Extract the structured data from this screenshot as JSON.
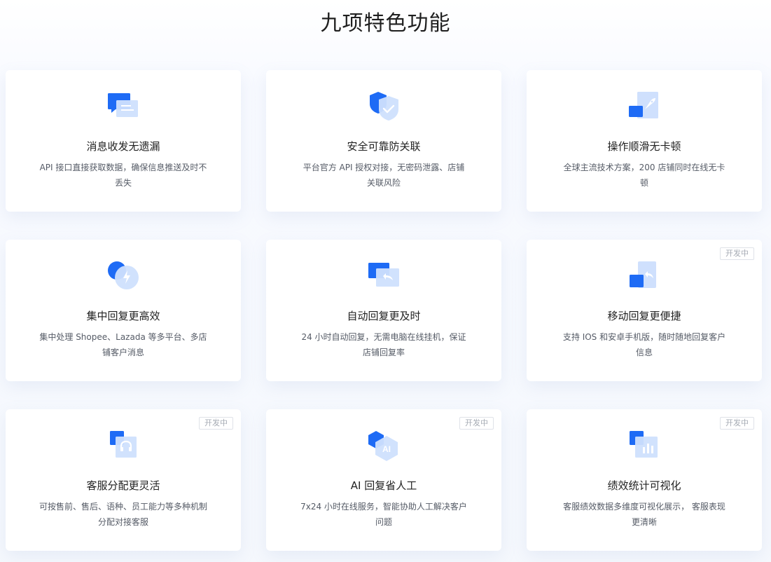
{
  "header": {
    "title": "九项特色功能"
  },
  "colors": {
    "accent": "#1e6bf5",
    "accent_light": "#cfe0fd"
  },
  "features": [
    {
      "title": "消息收发无遗漏",
      "desc": "API 接口直接获取数据，确保信息推送及时不丢失",
      "icon": "chat-bubbles-icon",
      "badge": ""
    },
    {
      "title": "安全可靠防关联",
      "desc": "平台官方 API 授权对接，无密码泄露、店铺关联风险",
      "icon": "shield-check-icon",
      "badge": ""
    },
    {
      "title": "操作顺滑无卡顿",
      "desc": "全球主流技术方案，200 店铺同时在线无卡顿",
      "icon": "rocket-icon",
      "badge": ""
    },
    {
      "title": "集中回复更高效",
      "desc": "集中处理 Shopee、Lazada 等多平台、多店铺客户消息",
      "icon": "lightning-bubble-icon",
      "badge": ""
    },
    {
      "title": "自动回复更及时",
      "desc": "24 小时自动回复，无需电脑在线挂机，保证店铺回复率",
      "icon": "auto-reply-icon",
      "badge": ""
    },
    {
      "title": "移动回复更便捷",
      "desc": "支持 IOS 和安卓手机版，随时随地回复客户信息",
      "icon": "mobile-reply-icon",
      "badge": "开发中"
    },
    {
      "title": "客服分配更灵活",
      "desc": "可按售前、售后、语种、员工能力等多种机制分配对接客服",
      "icon": "headset-icon",
      "badge": "开发中"
    },
    {
      "title": "AI 回复省人工",
      "desc": "7x24 小时在线服务，智能协助人工解决客户问题",
      "icon": "ai-hexagon-icon",
      "badge": "开发中"
    },
    {
      "title": "绩效统计可视化",
      "desc": "客服绩效数据多维度可视化展示， 客服表现更清晰",
      "icon": "bar-chart-icon",
      "badge": "开发中"
    }
  ]
}
